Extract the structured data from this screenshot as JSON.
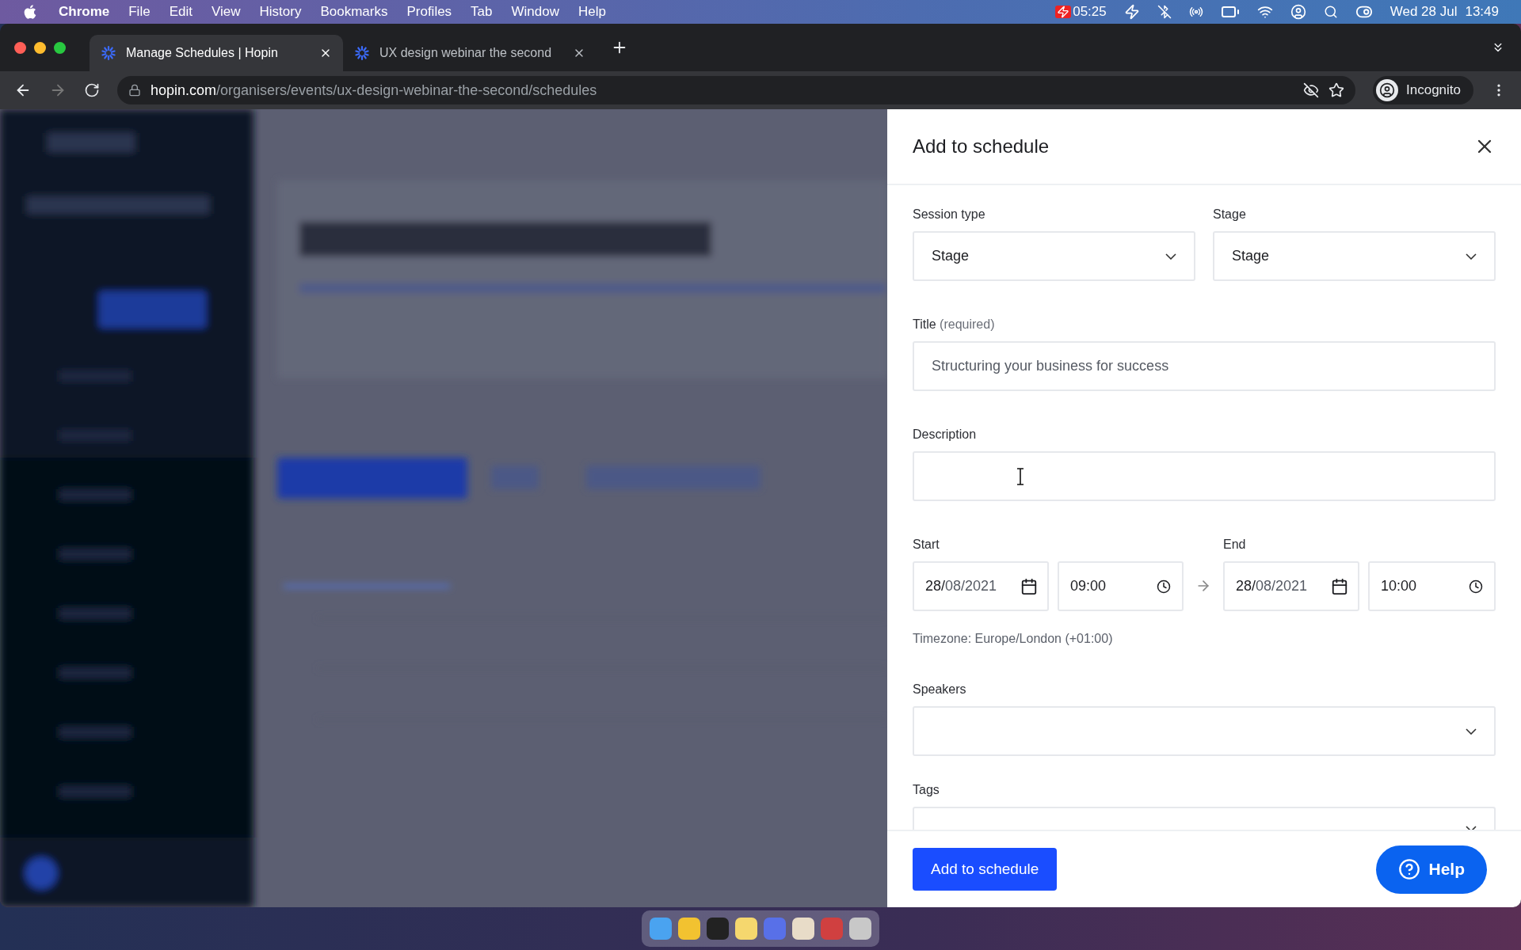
{
  "menu_bar": {
    "app": "Chrome",
    "menus": [
      "File",
      "Edit",
      "View",
      "History",
      "Bookmarks",
      "Profiles",
      "Tab",
      "Window",
      "Help"
    ],
    "recording_time": "05:25",
    "date": "Wed 28 Jul",
    "time": "13:49"
  },
  "tabs": [
    {
      "title": "Manage Schedules | Hopin",
      "selected": true
    },
    {
      "title": "UX design webinar the second",
      "selected": false
    }
  ],
  "address_bar": {
    "domain": "hopin.com",
    "path": "/organisers/events/ux-design-webinar-the-second/schedules",
    "profile": "Incognito"
  },
  "panel": {
    "title": "Add to schedule",
    "selects": [
      {
        "label": "Session type",
        "value": "Stage"
      },
      {
        "label": "Stage",
        "value": "Stage"
      }
    ],
    "title_field": {
      "label": "Title",
      "hint": "(required)",
      "value": "Structuring your business for success"
    },
    "description": {
      "label": "Description"
    },
    "start": {
      "label": "Start",
      "date_lead": "28/",
      "date_rest": "08/2021",
      "time": "09:00"
    },
    "end": {
      "label": "End",
      "date_lead": "28/",
      "date_rest": "08/2021",
      "time": "10:00"
    },
    "timezone": "Timezone: Europe/London (+01:00)",
    "speakers": {
      "label": "Speakers"
    },
    "tags": {
      "label": "Tags"
    },
    "submit": "Add to schedule",
    "help": "Help"
  }
}
